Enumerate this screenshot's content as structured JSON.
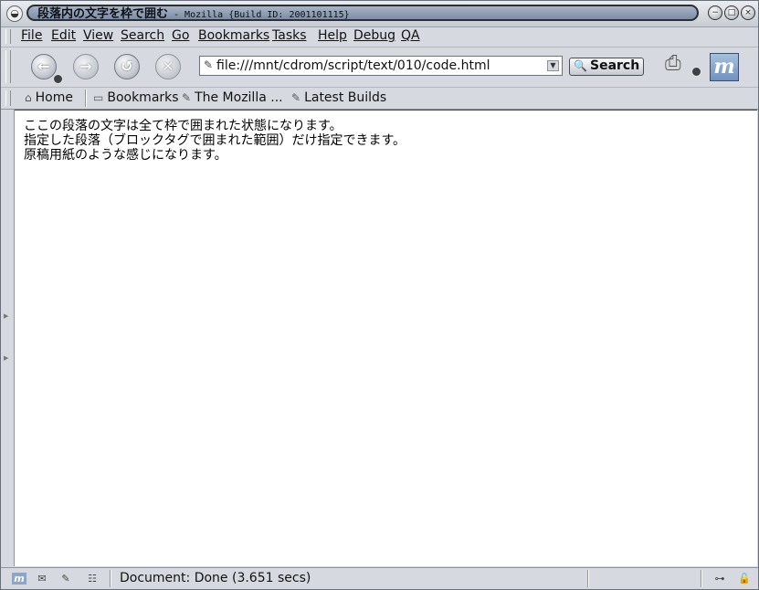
{
  "window": {
    "title": "段落内の文字を枠で囲む",
    "subtitle": "- Mozilla {Build ID: 2001101115}"
  },
  "menu": [
    "File",
    "Edit",
    "View",
    "Search",
    "Go",
    "Bookmarks",
    "Tasks",
    "Help",
    "Debug",
    "QA"
  ],
  "nav": {
    "url": "file:///mnt/cdrom/script/text/010/code.html",
    "search_label": "Search"
  },
  "personal_toolbar": {
    "home": "Home",
    "bookmarks": "Bookmarks",
    "mozilla": "The Mozilla ...",
    "builds": "Latest Builds"
  },
  "content": {
    "lines": [
      "ここの段落の文字は全て枠で囲まれた状態になります。",
      "指定した段落（ブロックタグで囲まれた範囲）だけ指定できます。",
      "原稿用紙のような感じになります。"
    ]
  },
  "status": {
    "text": "Document: Done (3.651 secs)"
  }
}
